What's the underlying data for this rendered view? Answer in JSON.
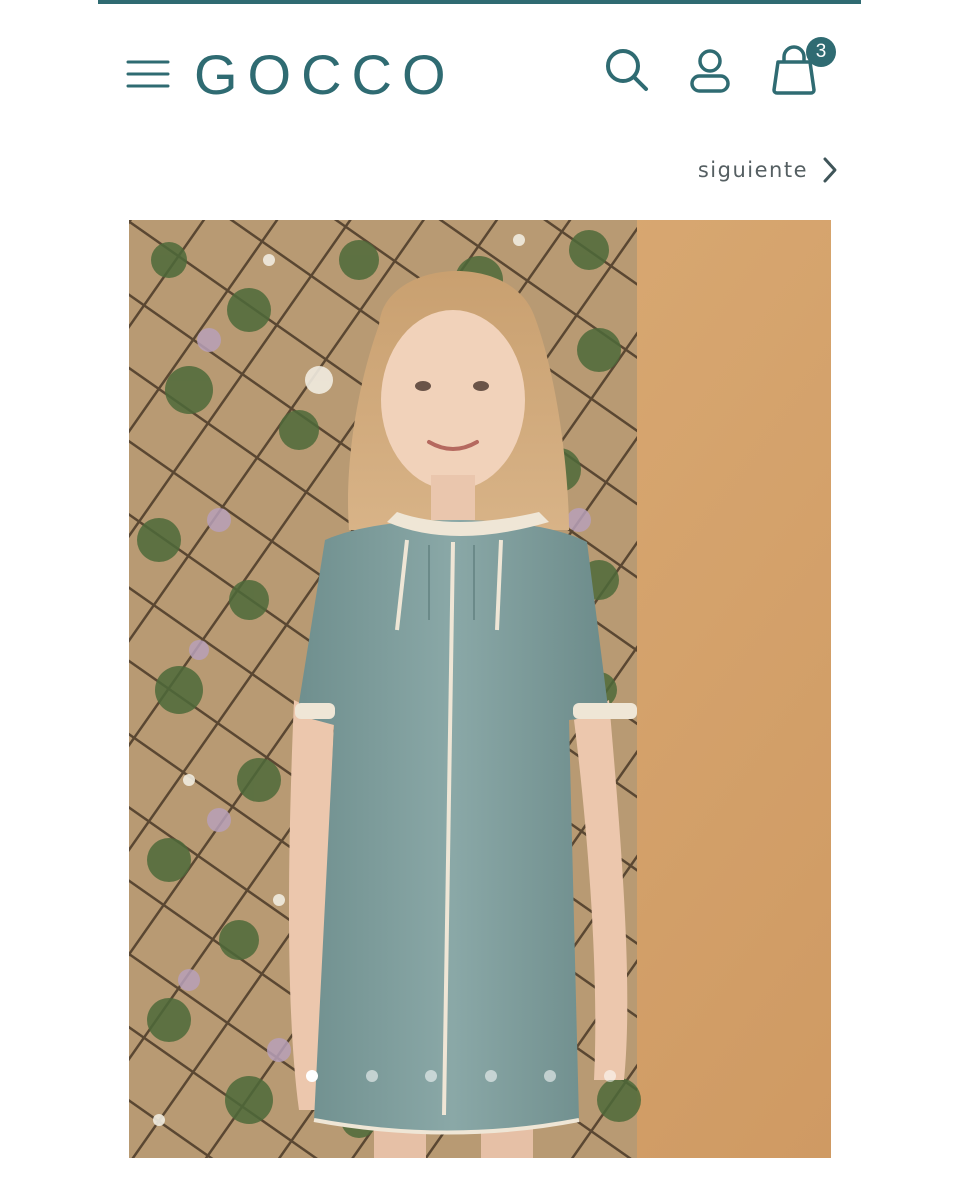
{
  "header": {
    "brand": "GOCCO",
    "menu_icon": "hamburger-menu-icon",
    "search_icon": "search-icon",
    "account_icon": "user-icon",
    "cart_icon": "shopping-bag-icon",
    "cart_count": "3"
  },
  "navigation": {
    "next_label": "siguiente",
    "next_icon": "chevron-right-icon"
  },
  "gallery": {
    "image_count": 6,
    "active_index": 0
  },
  "colors": {
    "brand": "#2f6b72",
    "background_photo": "#d7a36a",
    "dress": "#7f9f9e",
    "text_muted": "#555f62"
  }
}
